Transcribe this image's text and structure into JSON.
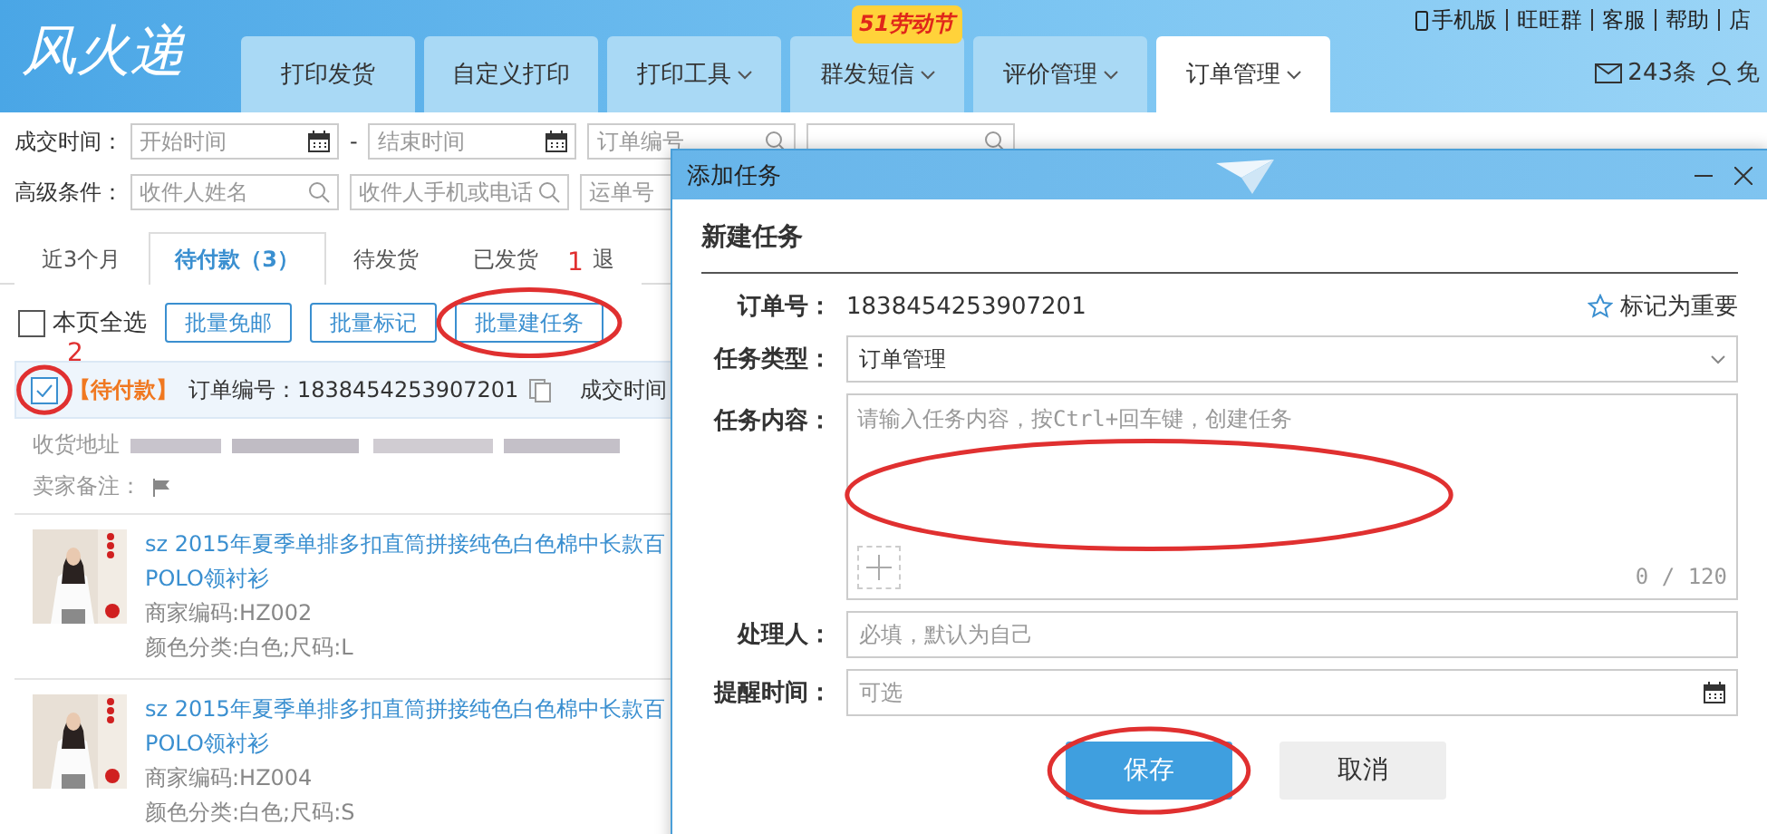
{
  "header": {
    "logo": "风火递",
    "promo_badge": "51劳动节",
    "top_links": [
      "手机版",
      "旺旺群",
      "客服",
      "帮助",
      "店"
    ],
    "messages": "243条",
    "user": "免",
    "nav_tabs": [
      {
        "label": "打印发货",
        "dropdown": false,
        "selected": false
      },
      {
        "label": "自定义打印",
        "dropdown": false,
        "selected": false
      },
      {
        "label": "打印工具",
        "dropdown": true,
        "selected": false
      },
      {
        "label": "群发短信",
        "dropdown": true,
        "selected": false
      },
      {
        "label": "评价管理",
        "dropdown": true,
        "selected": false
      },
      {
        "label": "订单管理",
        "dropdown": true,
        "selected": true
      }
    ]
  },
  "filters": [
    {
      "label": "成交时间：",
      "fields": [
        {
          "kind": "date",
          "placeholder": "开始时间"
        },
        {
          "kind": "separator",
          "text": "-"
        },
        {
          "kind": "date",
          "placeholder": "结束时间"
        },
        {
          "kind": "search",
          "placeholder": "订单编号"
        },
        {
          "kind": "search"
        }
      ]
    },
    {
      "label": "高级条件：",
      "fields": [
        {
          "kind": "search",
          "placeholder": "收件人姓名"
        },
        {
          "kind": "search",
          "placeholder": "收件人手机或电话"
        },
        {
          "kind": "plain",
          "placeholder": "运单号"
        }
      ]
    }
  ],
  "order_tabs": [
    {
      "label": "近3个月",
      "selected": false
    },
    {
      "label": "待付款（3）",
      "selected": true
    },
    {
      "label": "待发货",
      "selected": false
    },
    {
      "label": "已发货",
      "selected": false
    },
    {
      "label": "退",
      "selected": false
    }
  ],
  "bulk": {
    "select_all": {
      "label": "本页全选",
      "checked": false
    },
    "buttons": [
      {
        "label": "批量免邮",
        "circled": false
      },
      {
        "label": "批量标记",
        "circled": false
      },
      {
        "label": "批量建任务",
        "circled": true,
        "step": "1"
      }
    ]
  },
  "order": {
    "checked": true,
    "circled": true,
    "step": "2",
    "status": "【待付款】",
    "order_no": "订单编号：1838454253907201",
    "time_label": "成交时间",
    "address_label": "收货地址",
    "remark_label": "卖家备注：",
    "items": [
      {
        "title": [
          "sz 2015年夏季单排多扣直筒拼接纯色白色棉中长款百",
          "POLO领衬衫"
        ],
        "sku": "商家编码:HZ002",
        "variant": "颜色分类:白色;尺码:L"
      },
      {
        "title": [
          "sz 2015年夏季单排多扣直筒拼接纯色白色棉中长款百",
          "POLO领衬衫"
        ],
        "sku": "商家编码:HZ004",
        "variant": "颜色分类:白色;尺码:S"
      }
    ]
  },
  "dialog": {
    "title": "添加任务",
    "heading": "新建任务",
    "important": {
      "label": "标记为重要",
      "starred": false
    },
    "fields": [
      {
        "kind": "text",
        "label": "订单号：",
        "value": "1838454253907201"
      },
      {
        "kind": "select",
        "label": "任务类型：",
        "value": "订单管理"
      },
      {
        "kind": "textarea",
        "label": "任务内容：",
        "placeholder": "请输入任务内容，按Ctrl+回车键，创建任务",
        "counter": "0 / 120",
        "circled": true
      },
      {
        "kind": "input",
        "label": "处理人：",
        "placeholder": "必填，默认为自己"
      },
      {
        "kind": "date",
        "label": "提醒时间：",
        "placeholder": "可选"
      }
    ],
    "buttons": [
      {
        "label": "保存",
        "kind": "primary",
        "circled": true
      },
      {
        "label": "取消",
        "kind": "secondary",
        "circled": false
      }
    ]
  }
}
